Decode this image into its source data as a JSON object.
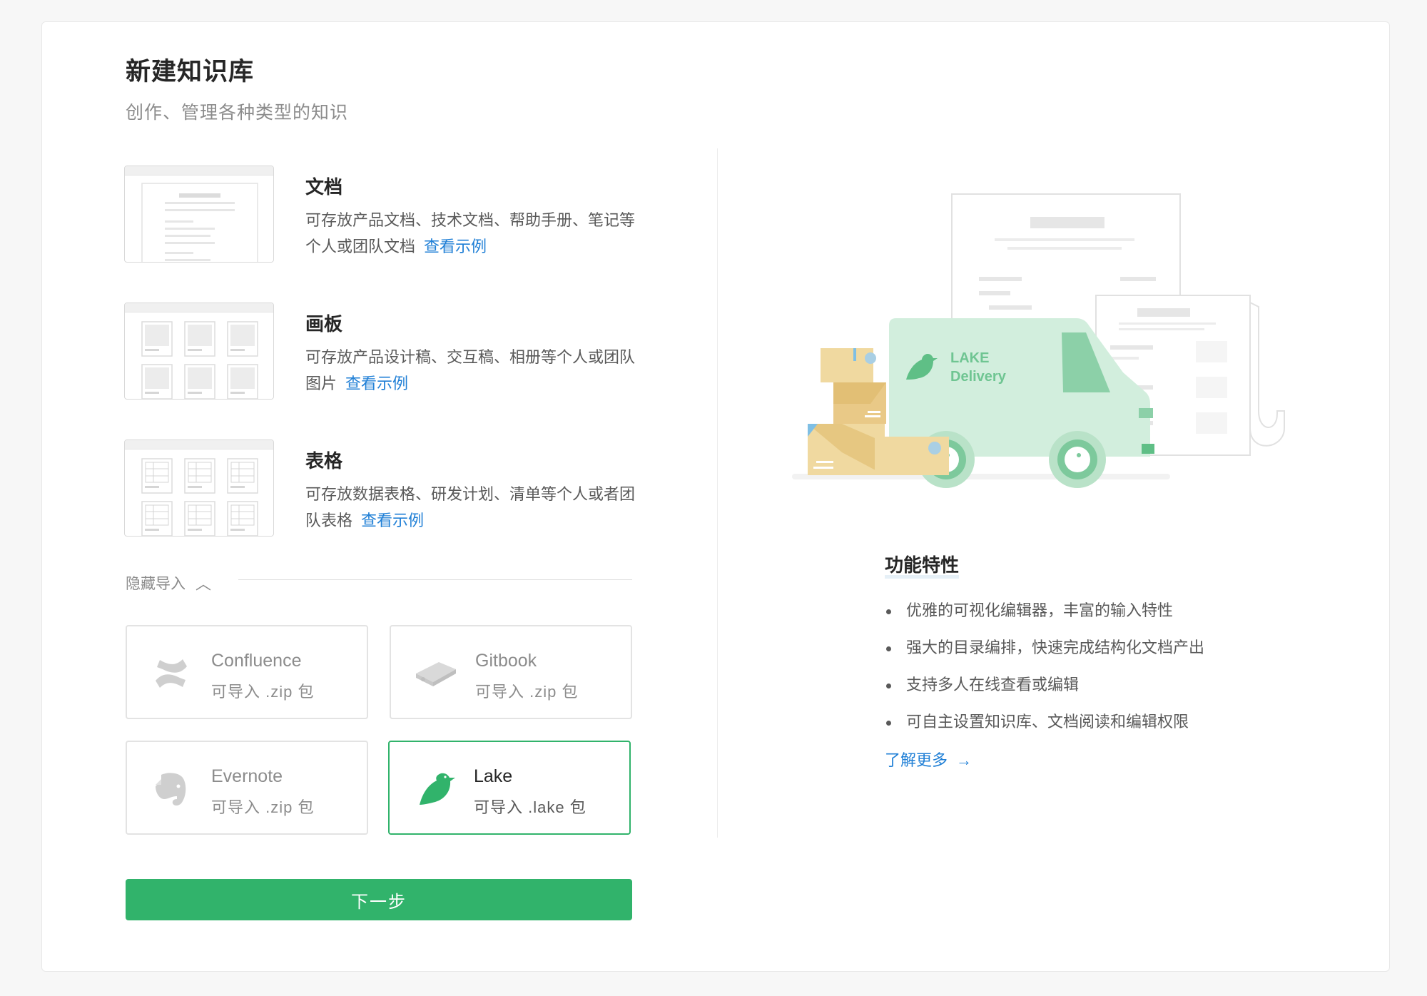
{
  "page": {
    "title": "新建知识库",
    "subtitle": "创作、管理各种类型的知识"
  },
  "types": [
    {
      "name": "文档",
      "desc": "可存放产品文档、技术文档、帮助手册、笔记等个人或团队文档",
      "link": "查看示例"
    },
    {
      "name": "画板",
      "desc": "可存放产品设计稿、交互稿、相册等个人或团队图片",
      "link": "查看示例"
    },
    {
      "name": "表格",
      "desc": "可存放数据表格、研发计划、清单等个人或者团队表格",
      "link": "查看示例"
    }
  ],
  "import_section": {
    "toggle_label": "隐藏导入",
    "sources": [
      {
        "name": "Confluence",
        "desc": "可导入 .zip 包",
        "selected": false
      },
      {
        "name": "Gitbook",
        "desc": "可导入 .zip 包",
        "selected": false
      },
      {
        "name": "Evernote",
        "desc": "可导入 .zip 包",
        "selected": false
      },
      {
        "name": "Lake",
        "desc": "可导入 .lake 包",
        "selected": true
      }
    ]
  },
  "next_button_label": "下一步",
  "illustration": {
    "truck_text_line1": "LAKE",
    "truck_text_line2": "Delivery"
  },
  "features": {
    "title": "功能特性",
    "items": [
      "优雅的可视化编辑器，丰富的输入特性",
      "强大的目录编排，快速完成结构化文档产出",
      "支持多人在线查看或编辑",
      "可自主设置知识库、文档阅读和编辑权限"
    ],
    "learn_more": "了解更多"
  },
  "colors": {
    "primary_green": "#31b36b",
    "link_blue": "#1f7fd6",
    "truck_green": "#d2eedd",
    "box_yellow": "#f0d9a0"
  }
}
